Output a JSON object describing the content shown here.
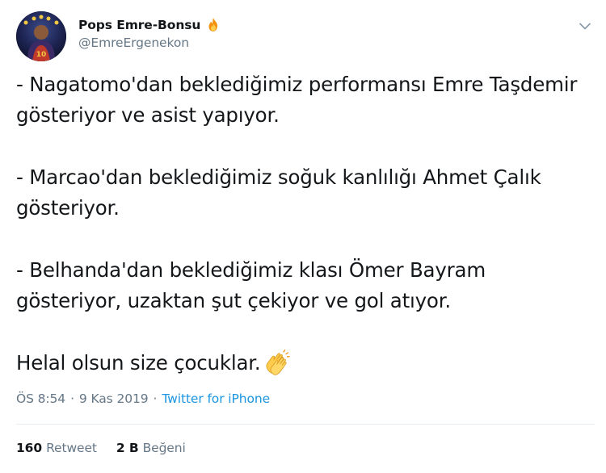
{
  "author": {
    "display_name": "Pops Emre-Bonsu",
    "handle": "@EmreErgenekon",
    "avatar_icon": "user-avatar",
    "badge_icon": "fire-icon"
  },
  "menu": {
    "icon": "chevron-down-icon"
  },
  "tweet": {
    "paragraphs": [
      "- Nagatomo'dan beklediğimiz performansı Emre Taşdemir gösteriyor ve asist yapıyor.",
      "- Marcao'dan beklediğimiz soğuk kanlılığı Ahmet Çalık gösteriyor.",
      "- Belhanda'dan beklediğimiz klası Ömer Bayram gösteriyor, uzaktan şut çekiyor ve gol atıyor."
    ],
    "closing": "Helal olsun size çocuklar.",
    "closing_emoji": "clapping-hands-icon"
  },
  "meta": {
    "time": "ÖS 8:54",
    "separator": "·",
    "date": "9 Kas 2019",
    "source": "Twitter for iPhone"
  },
  "stats": {
    "retweets_count": "160",
    "retweets_label": "Retweet",
    "likes_count": "2 B",
    "likes_label": "Beğeni"
  },
  "colors": {
    "text": "#14171a",
    "secondary": "#657786",
    "link": "#1b95e0",
    "divider": "#e6ecf0"
  }
}
